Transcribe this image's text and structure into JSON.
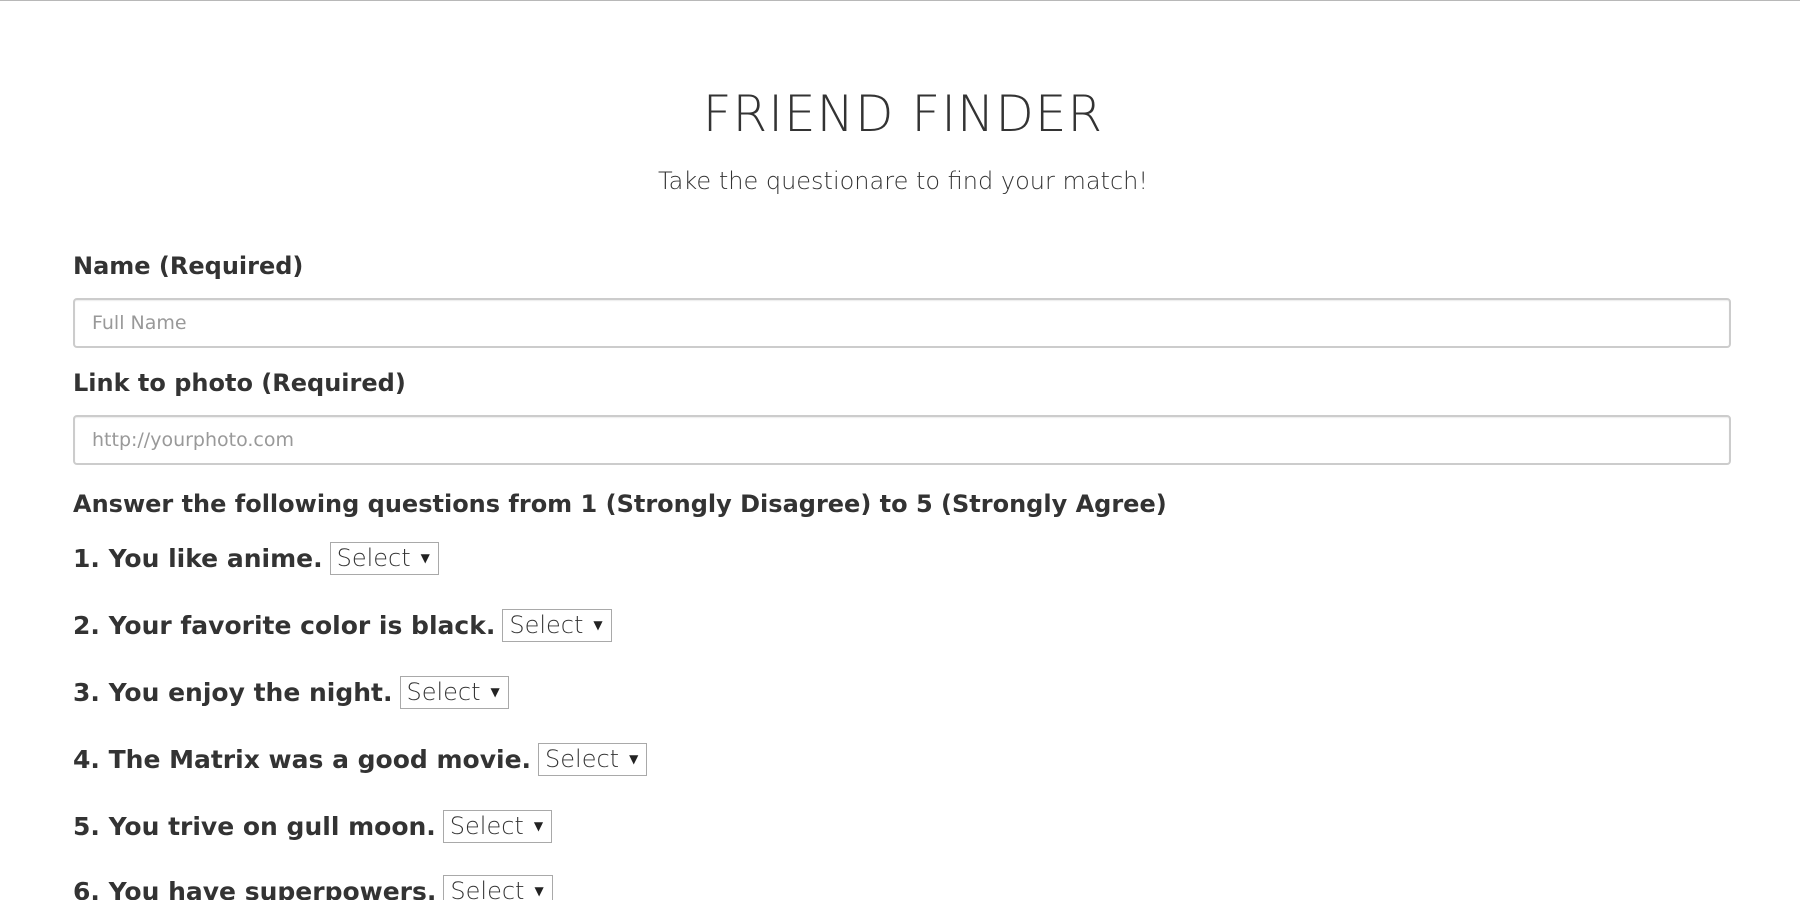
{
  "header": {
    "title": "FRIEND FINDER",
    "subtitle": "Take the questionare to find your match!"
  },
  "form": {
    "name_label": "Name (Required)",
    "name_placeholder": "Full Name",
    "name_value": "",
    "photo_label": "Link to photo (Required)",
    "photo_placeholder": "http://yourphoto.com",
    "photo_value": "",
    "instructions": "Answer the following questions from 1 (Strongly Disagree) to 5 (Strongly Agree)"
  },
  "questions": [
    {
      "text": "1. You like anime.",
      "selected": "Select"
    },
    {
      "text": "2. Your favorite color is black.",
      "selected": "Select"
    },
    {
      "text": "3. You enjoy the night.",
      "selected": "Select"
    },
    {
      "text": "4. The Matrix was a good movie.",
      "selected": "Select"
    },
    {
      "text": "5. You trive on gull moon.",
      "selected": "Select"
    },
    {
      "text": "6. You have superpowers.",
      "selected": "Select"
    }
  ],
  "icons": {
    "dropdown_arrow": "chevron-down-icon"
  },
  "colors": {
    "text": "#333333",
    "input_border": "#cccccc",
    "placeholder": "#999999",
    "background": "#ffffff"
  }
}
